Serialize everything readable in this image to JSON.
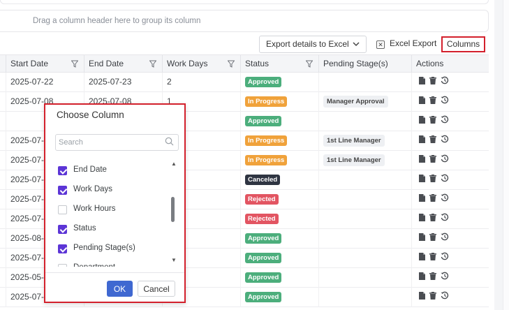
{
  "group_panel": {
    "hint": "Drag a column header here to group its column"
  },
  "toolbar": {
    "export_details_label": "Export details to Excel",
    "excel_export_label": "Excel Export",
    "columns_label": "Columns"
  },
  "grid": {
    "headers": [
      "Start Date",
      "End Date",
      "Work Days",
      "Status",
      "Pending Stage(s)",
      "Actions"
    ],
    "rows": [
      {
        "start": "2025-07-22",
        "end": "2025-07-23",
        "days": "2",
        "status": "Approved",
        "stage": ""
      },
      {
        "start": "2025-07-08",
        "end": "2025-07-08",
        "days": "1",
        "status": "In Progress",
        "stage": "Manager Approval"
      },
      {
        "start": "",
        "end": "",
        "days": "",
        "status": "Approved",
        "stage": ""
      },
      {
        "start": "2025-07-",
        "end": "",
        "days": "",
        "status": "In Progress",
        "stage": "1st Line Manager"
      },
      {
        "start": "2025-07-",
        "end": "",
        "days": "",
        "status": "In Progress",
        "stage": "1st Line Manager"
      },
      {
        "start": "2025-07-",
        "end": "",
        "days": "",
        "status": "Canceled",
        "stage": ""
      },
      {
        "start": "2025-07-",
        "end": "",
        "days": "",
        "status": "Rejected",
        "stage": ""
      },
      {
        "start": "2025-07-",
        "end": "",
        "days": "",
        "status": "Rejected",
        "stage": ""
      },
      {
        "start": "2025-08-",
        "end": "",
        "days": "",
        "status": "Approved",
        "stage": ""
      },
      {
        "start": "2025-07-",
        "end": "",
        "days": "",
        "status": "Approved",
        "stage": ""
      },
      {
        "start": "2025-05-",
        "end": "",
        "days": "",
        "status": "Approved",
        "stage": ""
      },
      {
        "start": "2025-07-",
        "end": "",
        "days": "",
        "status": "Approved",
        "stage": ""
      }
    ]
  },
  "status_colors": {
    "Approved": "#4cae7c",
    "In Progress": "#f0a23b",
    "Canceled": "#2f3542",
    "Rejected": "#e25562"
  },
  "action_icons": [
    "file-icon",
    "trash-icon",
    "history-icon"
  ],
  "column_chooser": {
    "title": "Choose Column",
    "search_placeholder": "Search",
    "items": [
      {
        "label": "End Date",
        "checked": true
      },
      {
        "label": "Work Days",
        "checked": true
      },
      {
        "label": "Work Hours",
        "checked": false
      },
      {
        "label": "Status",
        "checked": true
      },
      {
        "label": "Pending Stage(s)",
        "checked": true
      },
      {
        "label": "Department",
        "checked": false
      }
    ],
    "ok_label": "OK",
    "cancel_label": "Cancel"
  }
}
